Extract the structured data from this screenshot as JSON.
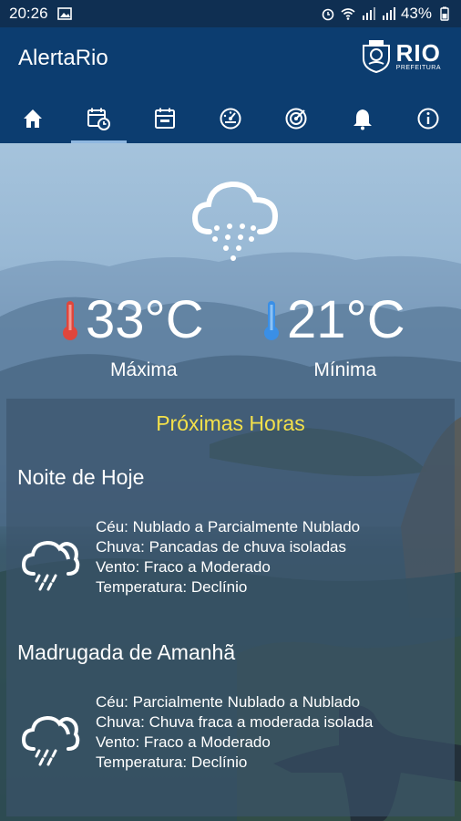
{
  "status_bar": {
    "time": "20:26",
    "battery": "43%"
  },
  "app": {
    "title": "AlertaRio",
    "logo_text": "RIO",
    "logo_subtext": "PREFEITURA"
  },
  "tabs": [
    {
      "icon": "home-icon"
    },
    {
      "icon": "calendar-clock-icon",
      "active": true
    },
    {
      "icon": "calendar-icon"
    },
    {
      "icon": "gauge-icon"
    },
    {
      "icon": "radar-icon"
    },
    {
      "icon": "bell-icon"
    },
    {
      "icon": "info-icon"
    }
  ],
  "today": {
    "max_temp": "33°C",
    "max_label": "Máxima",
    "min_temp": "21°C",
    "min_label": "Mínima"
  },
  "forecast": {
    "title": "Próximas Horas",
    "periods": [
      {
        "name": "Noite de Hoje",
        "ceu": "Céu: Nublado a Parcialmente Nublado",
        "chuva": "Chuva: Pancadas de chuva isoladas",
        "vento": "Vento: Fraco a Moderado",
        "temperatura": "Temperatura: Declínio"
      },
      {
        "name": "Madrugada de Amanhã",
        "ceu": "Céu: Parcialmente Nublado a Nublado",
        "chuva": "Chuva: Chuva fraca a moderada isolada",
        "vento": "Vento: Fraco a Moderado",
        "temperatura": "Temperatura: Declínio"
      }
    ]
  },
  "colors": {
    "status_bar": "#0f2f52",
    "app_bar": "#0c3d70",
    "panel_title": "#f3e04a",
    "max_thermo": "#e0463c",
    "min_thermo": "#3a8fe6"
  }
}
